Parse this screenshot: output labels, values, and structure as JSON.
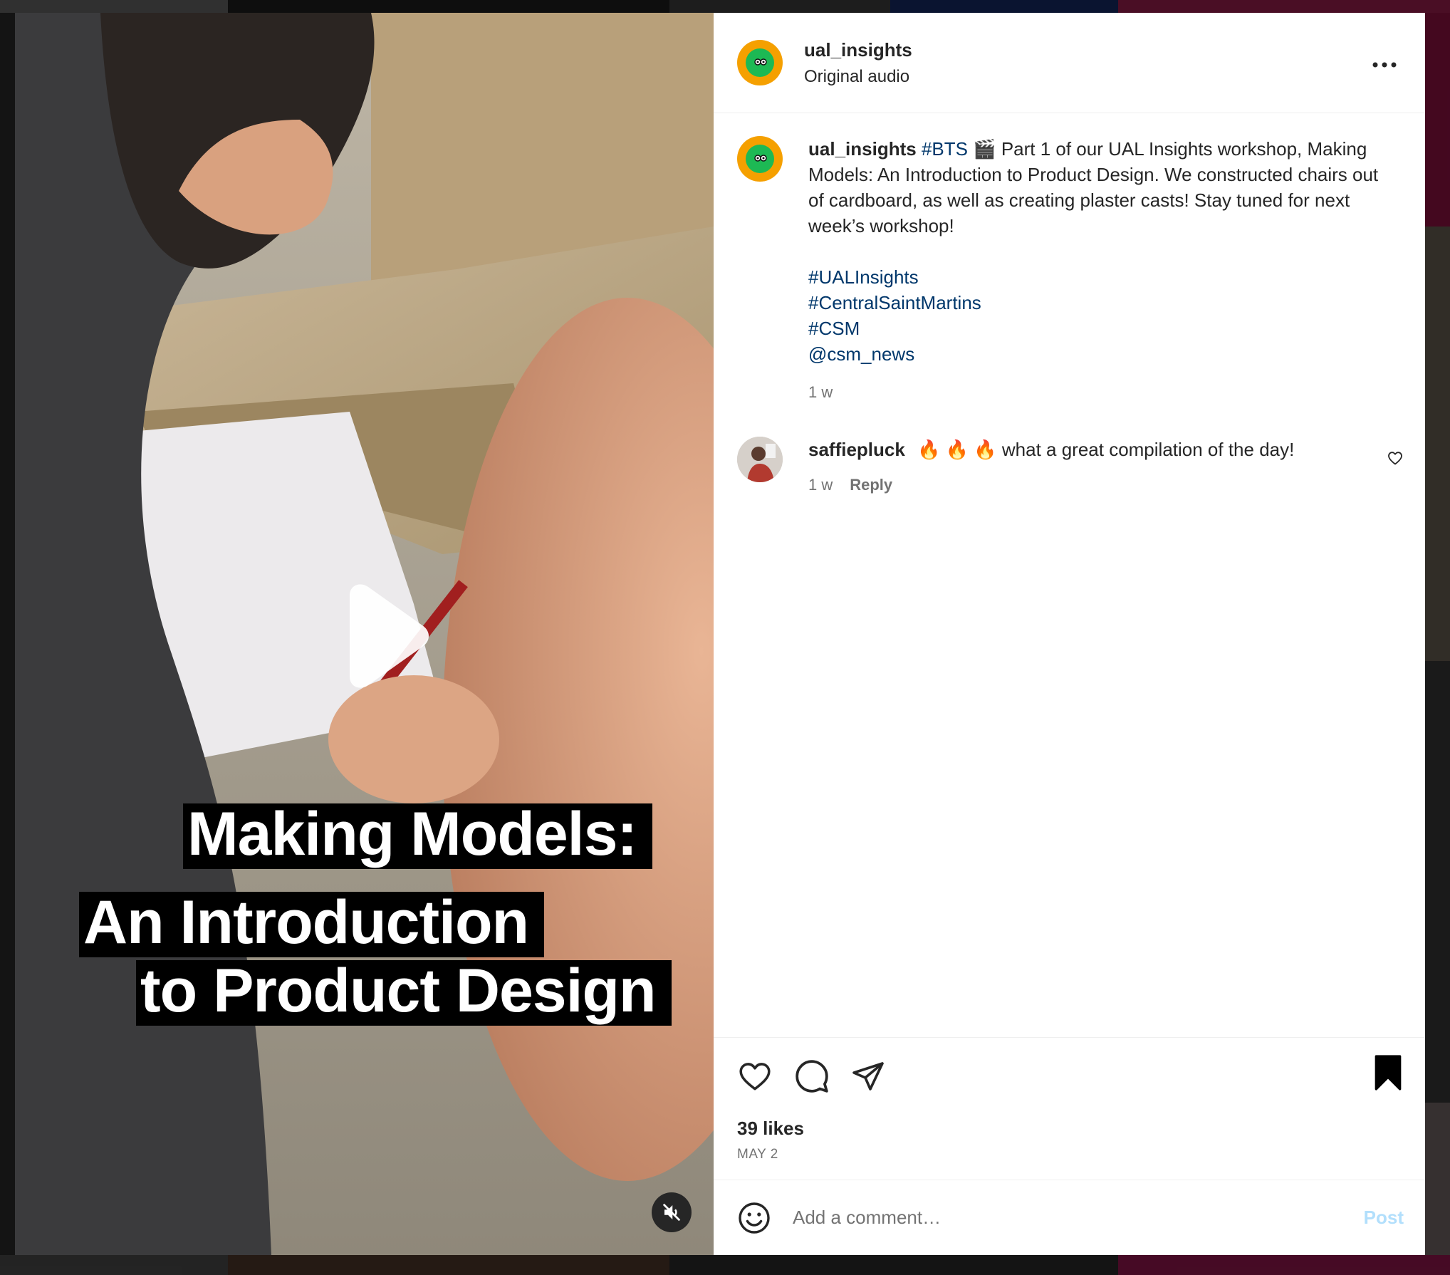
{
  "post": {
    "username": "ual_insights",
    "audio": "Original audio",
    "more_icon": "more-horizontal-icon",
    "caption": {
      "username": "ual_insights",
      "tag_bts": "#BTS",
      "clapper_emoji": "🎬",
      "text": " Part 1 of our UAL Insights workshop, Making Models: An Introduction to Product Design. We constructed chairs out of cardboard, as well as creating plaster casts! Stay tuned for next week’s workshop!",
      "tags": [
        "#UALInsights",
        "#CentralSaintMartins",
        "#CSM",
        "@csm_news"
      ],
      "time": "1 w"
    },
    "comments": [
      {
        "username": "saffiepluck",
        "fire_emojis": "🔥 🔥 🔥",
        "text": " what a great compilation of the day!",
        "time": "1 w",
        "reply_label": "Reply"
      }
    ],
    "likes": "39 likes",
    "date": "MAY 2",
    "add_comment": {
      "placeholder": "Add a comment…",
      "post_label": "Post"
    }
  },
  "video": {
    "title_lines": [
      "Making Models:",
      "An Introduction",
      "to Product Design"
    ],
    "muted": true
  },
  "colors": {
    "link": "#00376b",
    "post_disabled": "#b2dffc",
    "avatar_ring": "#f5a000",
    "avatar_face": "#1db954"
  }
}
